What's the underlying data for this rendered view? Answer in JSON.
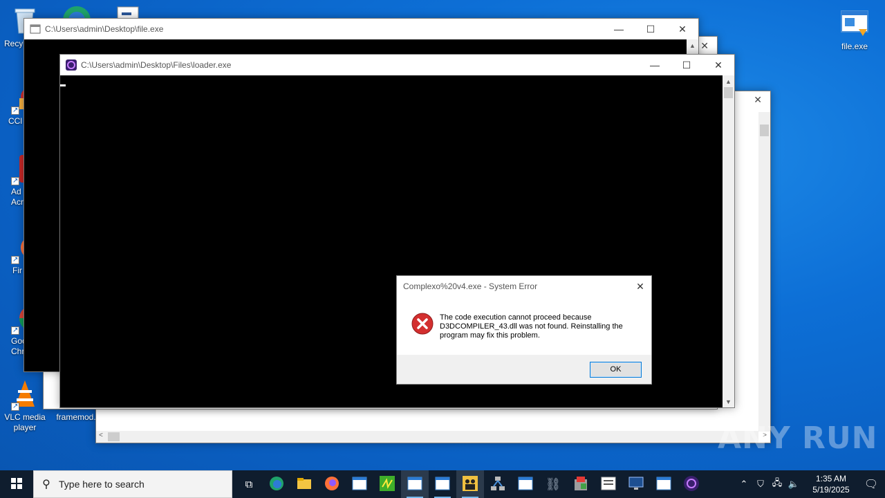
{
  "desktop": {
    "icons_left": [
      {
        "label": "Recy",
        "name": "recycle-bin"
      },
      {
        "label": "CCl",
        "name": "ccleaner"
      },
      {
        "label": "Ad\nAcr",
        "name": "adobe-acrobat"
      },
      {
        "label": "Fir",
        "name": "firefox"
      },
      {
        "label": "Goo\nChr",
        "name": "google-chrome"
      },
      {
        "label": "VLC media player",
        "name": "vlc"
      },
      {
        "label": "framemod.",
        "name": "framemod"
      }
    ],
    "icon_right": {
      "label": "file.exe"
    }
  },
  "windows": {
    "file": {
      "title": "C:\\Users\\admin\\Desktop\\file.exe"
    },
    "loader": {
      "title": "C:\\Users\\admin\\Desktop\\Files\\loader.exe"
    }
  },
  "dialog": {
    "title": "Complexo%20v4.exe - System Error",
    "message": "The code execution cannot proceed because D3DCOMPILER_43.dll was not found. Reinstalling the program may fix this problem.",
    "ok_label": "OK"
  },
  "taskbar": {
    "search_placeholder": "Type here to search",
    "time": "1:35 AM",
    "date": "5/19/2025"
  },
  "watermark": "ANY RUN"
}
